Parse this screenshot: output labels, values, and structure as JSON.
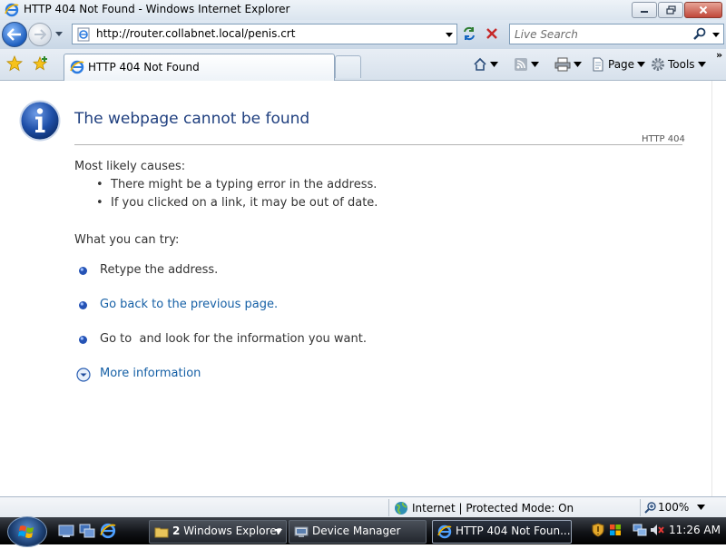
{
  "window": {
    "title": "HTTP 404 Not Found - Windows Internet Explorer",
    "icon": "ie-icon"
  },
  "address_bar": {
    "url": "http://router.collabnet.local/penis.crt",
    "search_placeholder": "Live Search"
  },
  "tab": {
    "label": "HTTP 404 Not Found"
  },
  "command_bar": {
    "page_label": "Page",
    "tools_label": "Tools"
  },
  "error_page": {
    "title": "The webpage cannot be found",
    "code": "HTTP 404",
    "causes_heading": "Most likely causes:",
    "causes": [
      "There might be a typing error in the address.",
      "If you clicked on a link, it may be out of date."
    ],
    "try_heading": "What you can try:",
    "try_items": [
      {
        "text": "Retype the address.",
        "link": false
      },
      {
        "text": "Go back to the previous page.",
        "link": true
      },
      {
        "text": "Go to  and look for the information you want.",
        "link": false
      }
    ],
    "more_info": "More information"
  },
  "status_bar": {
    "zone": "Internet | Protected Mode: On",
    "zoom": "100%"
  },
  "taskbar": {
    "buttons": [
      {
        "count": "2",
        "label": "Windows Explorer"
      },
      {
        "label": "Device Manager"
      },
      {
        "label": "HTTP 404 Not Foun..."
      }
    ],
    "clock": "11:26 AM"
  },
  "colors": {
    "title_blue": "#1f3f7f",
    "link_blue": "#1660a6",
    "info_icon_blue": "#1e4fa8"
  }
}
